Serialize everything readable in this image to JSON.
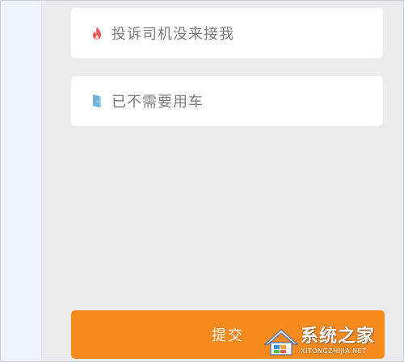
{
  "options": [
    {
      "label": "投诉司机没来接我",
      "icon": "flame-icon",
      "icon_color": "#f25b5b"
    },
    {
      "label": "已不需要用车",
      "icon": "door-icon",
      "icon_color": "#6fb4d8"
    }
  ],
  "submit": {
    "label": "提交",
    "color": "#f68a1d"
  },
  "watermark": {
    "site_name": "系统之家",
    "site_url": "XITONGZHIJIA.NET"
  }
}
